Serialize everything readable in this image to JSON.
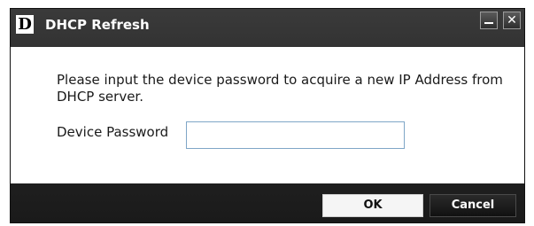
{
  "window": {
    "title": "DHCP Refresh",
    "logo_letter": "D",
    "minimize_label": "",
    "close_label": "✕"
  },
  "content": {
    "message": "Please input the device password to acquire a new IP Address from DHCP server.",
    "password_label": "Device Password",
    "password_value": "",
    "password_placeholder": ""
  },
  "buttons": {
    "ok_label": "OK",
    "cancel_label": "Cancel"
  },
  "colors": {
    "titlebar": "#2a2a2a",
    "content_bg": "#ffffff",
    "input_border": "#7fa6c7"
  }
}
